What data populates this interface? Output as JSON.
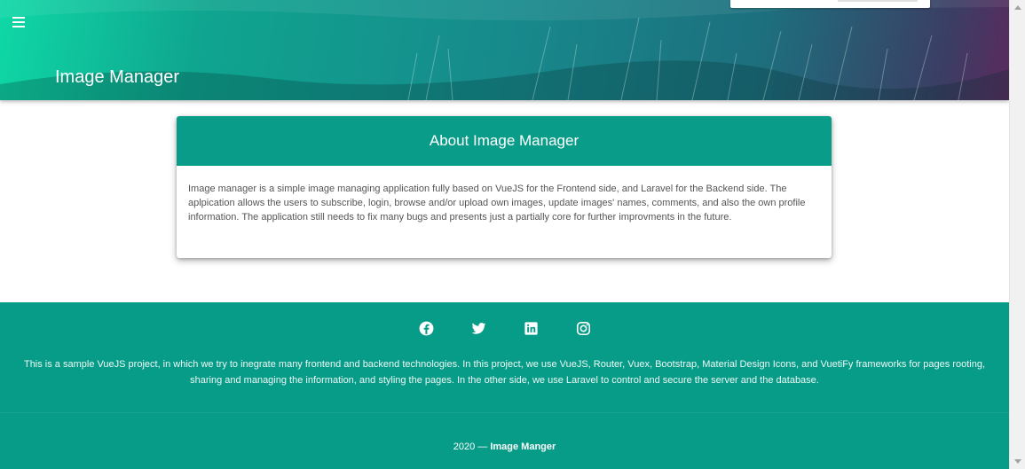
{
  "header": {
    "title": "Image Manager",
    "menu_icon": "menu-icon"
  },
  "about": {
    "heading": "About Image Manager",
    "body": "Image manager is a simple image managing application fully based on VueJS for the Frontend side, and Laravel for the Backend side. The aplpication allows the users to subscribe, login, browse and/or upload own images, update images' names, comments, and also the own profile information. The application still needs to fix many bugs and presents just a partially core for further improvments in the future."
  },
  "footer": {
    "social_icons": [
      "facebook-icon",
      "twitter-icon",
      "linkedin-icon",
      "instagram-icon"
    ],
    "description": "This is a sample VueJS project, in which we try to inegrate many frontend and backend technologies. In this project, we use VueJS, Router, Vuex, Bootstrap, Material Design Icons, and VuetiFy frameworks for pages rooting, sharing and managing the information, and styling the pages. In the other side, we use Laravel to control and secure the server and the database.",
    "copyright_prefix": "2020 —",
    "copyright_name": "Image Manger"
  },
  "colors": {
    "primary": "#099d89",
    "footer": "#079c88"
  }
}
